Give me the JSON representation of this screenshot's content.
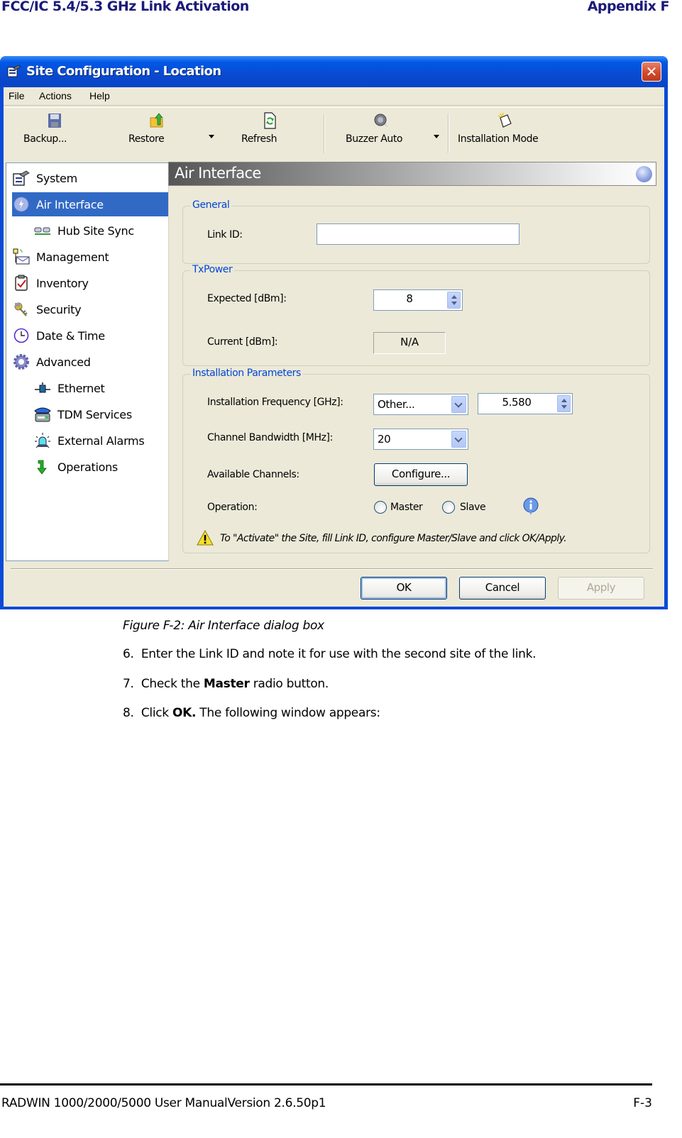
{
  "page_header": {
    "left": "FCC/IC 5.4/5.3 GHz Link Activation",
    "right": "Appendix F"
  },
  "window": {
    "title": "Site Configuration - Location",
    "close_glyph": "✕",
    "menu": [
      "File",
      "Actions",
      "Help"
    ],
    "toolbar": {
      "backup": "Backup...",
      "restore": "Restore",
      "refresh": "Refresh",
      "buzzer": "Buzzer Auto",
      "installation_mode": "Installation Mode"
    },
    "tree": [
      {
        "label": "System",
        "icon": "system-icon",
        "level": 0
      },
      {
        "label": "Air Interface",
        "icon": "air-interface-icon",
        "level": 0,
        "selected": true
      },
      {
        "label": "Hub Site Sync",
        "icon": "hub-sync-icon",
        "level": 1
      },
      {
        "label": "Management",
        "icon": "management-icon",
        "level": 0
      },
      {
        "label": "Inventory",
        "icon": "inventory-icon",
        "level": 0
      },
      {
        "label": "Security",
        "icon": "security-icon",
        "level": 0
      },
      {
        "label": "Date & Time",
        "icon": "clock-icon",
        "level": 0
      },
      {
        "label": "Advanced",
        "icon": "gear-icon",
        "level": 0
      },
      {
        "label": "Ethernet",
        "icon": "ethernet-icon",
        "level": 1
      },
      {
        "label": "TDM Services",
        "icon": "telephone-icon",
        "level": 1
      },
      {
        "label": "External Alarms",
        "icon": "alarm-icon",
        "level": 1
      },
      {
        "label": "Operations",
        "icon": "arrow-down-icon",
        "level": 1
      }
    ],
    "pane": {
      "title": "Air Interface",
      "general": {
        "title": "General",
        "link_id_label": "Link ID:",
        "link_id_value": ""
      },
      "txpower": {
        "title": "TxPower",
        "expected_label": "Expected [dBm]:",
        "expected_value": "8",
        "current_label": "Current [dBm]:",
        "current_value": "N/A"
      },
      "install": {
        "title": "Installation Parameters",
        "freq_label": "Installation Frequency [GHz]:",
        "freq_select": "Other...",
        "freq_value": "5.580",
        "bw_label": "Channel Bandwidth [MHz]:",
        "bw_value": "20",
        "channels_label": "Available Channels:",
        "configure_button": "Configure...",
        "operation_label": "Operation:",
        "master_label": "Master",
        "slave_label": "Slave",
        "master_checked": false,
        "slave_checked": false,
        "warning": "To \"Activate\" the Site, fill Link ID, configure Master/Slave and click OK/Apply."
      }
    },
    "buttons": {
      "ok": "OK",
      "cancel": "Cancel",
      "apply": "Apply"
    }
  },
  "document": {
    "caption": "Figure F-2: Air Interface dialog box",
    "steps": [
      {
        "num": "6.",
        "pre": "Enter the Link ID and note it for use with the second site of the link.",
        "bold": "",
        "post": ""
      },
      {
        "num": "7.",
        "pre": "Check the ",
        "bold": "Master",
        "post": " radio button."
      },
      {
        "num": "8.",
        "pre": "Click ",
        "bold": "OK.",
        "post": " The following window appears:"
      }
    ]
  },
  "footer": {
    "left": "RADWIN 1000/2000/5000 User ManualVersion  2.6.50p1",
    "right": "F-3"
  },
  "colors": {
    "title_bar": "#0a4ad0",
    "selection": "#316ac5",
    "group_title": "#0046d5",
    "dialog_bg": "#ece9d8",
    "header_text": "#1a1a7a"
  }
}
